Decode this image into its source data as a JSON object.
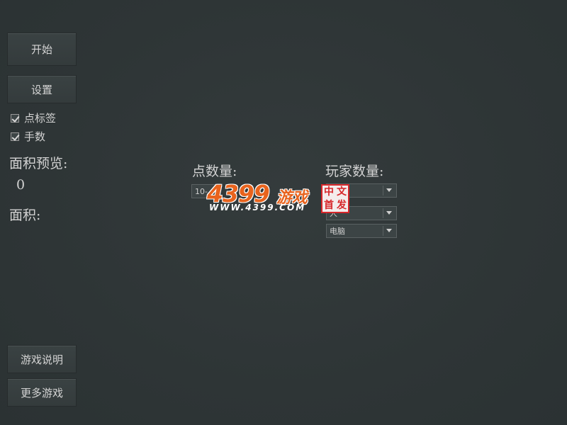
{
  "menu": {
    "start_label": "开始",
    "settings_label": "设置",
    "instructions_label": "游戏说明",
    "more_games_label": "更多游戏"
  },
  "options": {
    "point_labels": {
      "label": "点标签",
      "checked": true
    },
    "move_count": {
      "label": "手数",
      "checked": true
    }
  },
  "stats": {
    "area_preview_label": "面积预览:",
    "area_preview_value": "0",
    "area_label": "面积:"
  },
  "setup": {
    "point_count_label": "点数量:",
    "point_count_value": "10-",
    "player_count_label": "玩家数量:",
    "player_selects": [
      "",
      "人",
      "电脑"
    ]
  },
  "logo": {
    "main": "4399",
    "suffix": "游戏",
    "url": "WWW.4399.COM",
    "seal_chars": [
      "中",
      "文",
      "首",
      "发"
    ]
  },
  "colors": {
    "background": "#2f3637",
    "logo_orange": "#e8631d",
    "seal_red": "#d7262a"
  }
}
